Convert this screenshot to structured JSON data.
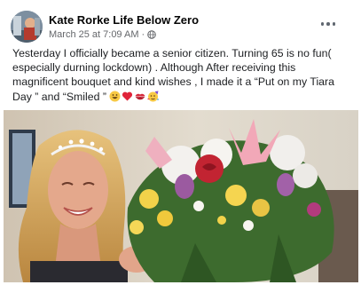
{
  "post": {
    "author_name": "Kate Rorke Life Below Zero",
    "timestamp": "March 25 at 7:09 AM",
    "separator": "·",
    "privacy_icon": "globe-icon",
    "more_icon": "more-options-icon",
    "text_lines": [
      "Yesterday I officially became a senior citizen. Turning 65 is no fun(",
      "especially durning lockdown) . Although After receiving this",
      "magnificent bouquet and kind wishes , I made it a “Put on my Tiara",
      "Day ” and “Smiled ”"
    ],
    "emojis": [
      "grinning-face",
      "red-heart",
      "kiss-mark",
      "partying-face"
    ],
    "photo": {
      "subject": "woman-with-tiara-holding-bouquet"
    }
  },
  "colors": {
    "name": "#050505",
    "meta": "#65676b",
    "text": "#1c1e21"
  }
}
